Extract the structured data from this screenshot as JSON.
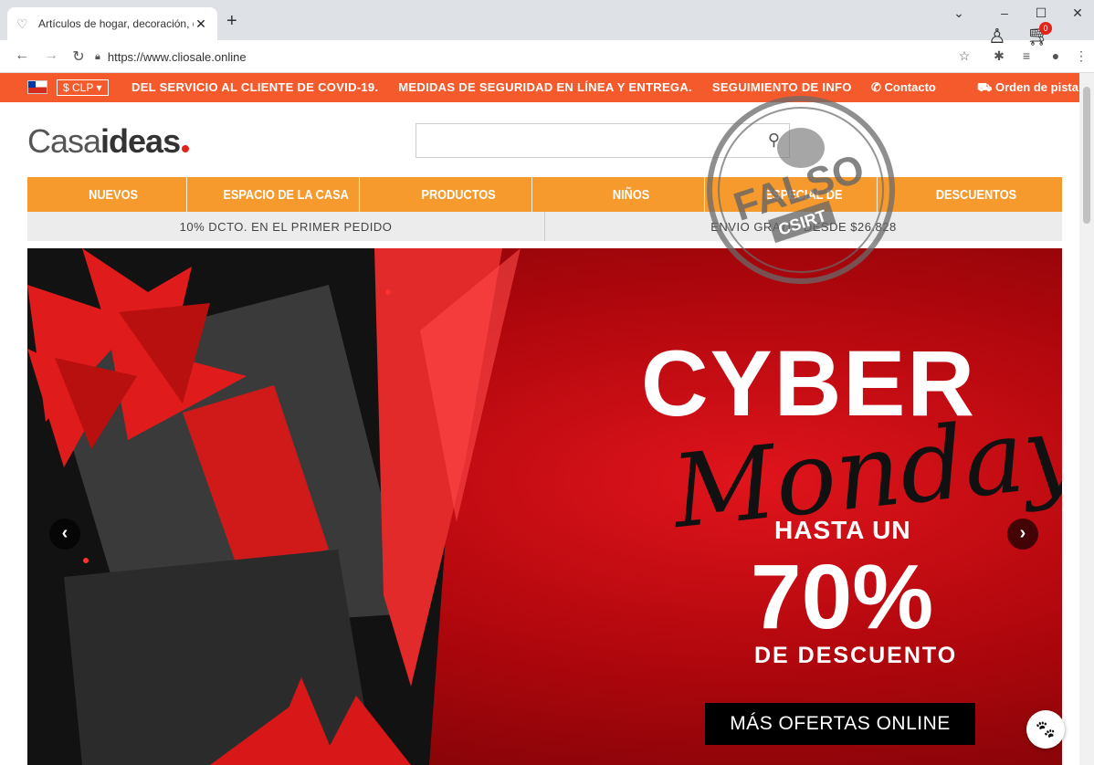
{
  "browser": {
    "tab_title": "Artículos de hogar, decoración, o",
    "tab_close": "✕",
    "new_tab": "+",
    "url": "https://www.cliosale.online",
    "controls": {
      "minimize": "–",
      "maximize": "☐",
      "close": "✕",
      "dropdown": "⌄"
    }
  },
  "promo_bar": {
    "currency": "$ CLP ▾",
    "messages": [
      "DEL SERVICIO AL CLIENTE DE COVID-19.",
      "MEDIDAS DE SEGURIDAD EN LÍNEA Y ENTREGA.",
      "SEGUIMIENTO DE INFO"
    ],
    "contact": "✆ Contacto",
    "track": "⛟ Orden de pista"
  },
  "header": {
    "logo_light": "Casa",
    "logo_bold": "ideas",
    "cart_count": "0"
  },
  "menu": {
    "items": [
      "NUEVOS",
      "ESPACIO DE LA CASA",
      "PRODUCTOS",
      "NIÑOS",
      "ESPECIAL DE",
      "DESCUENTOS"
    ]
  },
  "info": {
    "left": "10% DCTO. EN EL PRIMER PEDIDO",
    "right": "ENVIO GRATIS DESDE $26.828"
  },
  "hero": {
    "line1": "CYBER",
    "line2": "Monday",
    "line3": "HASTA UN",
    "line4": "70%",
    "line5": "DE DESCUENTO",
    "cta": "MÁS OFERTAS ONLINE",
    "prev": "‹",
    "next": "›"
  },
  "stamp": {
    "text": "FALSO",
    "sub": "CSIRT"
  },
  "colors": {
    "promo": "#f55a2c",
    "menu": "#f79a2d",
    "hero_red": "#c80b12"
  }
}
